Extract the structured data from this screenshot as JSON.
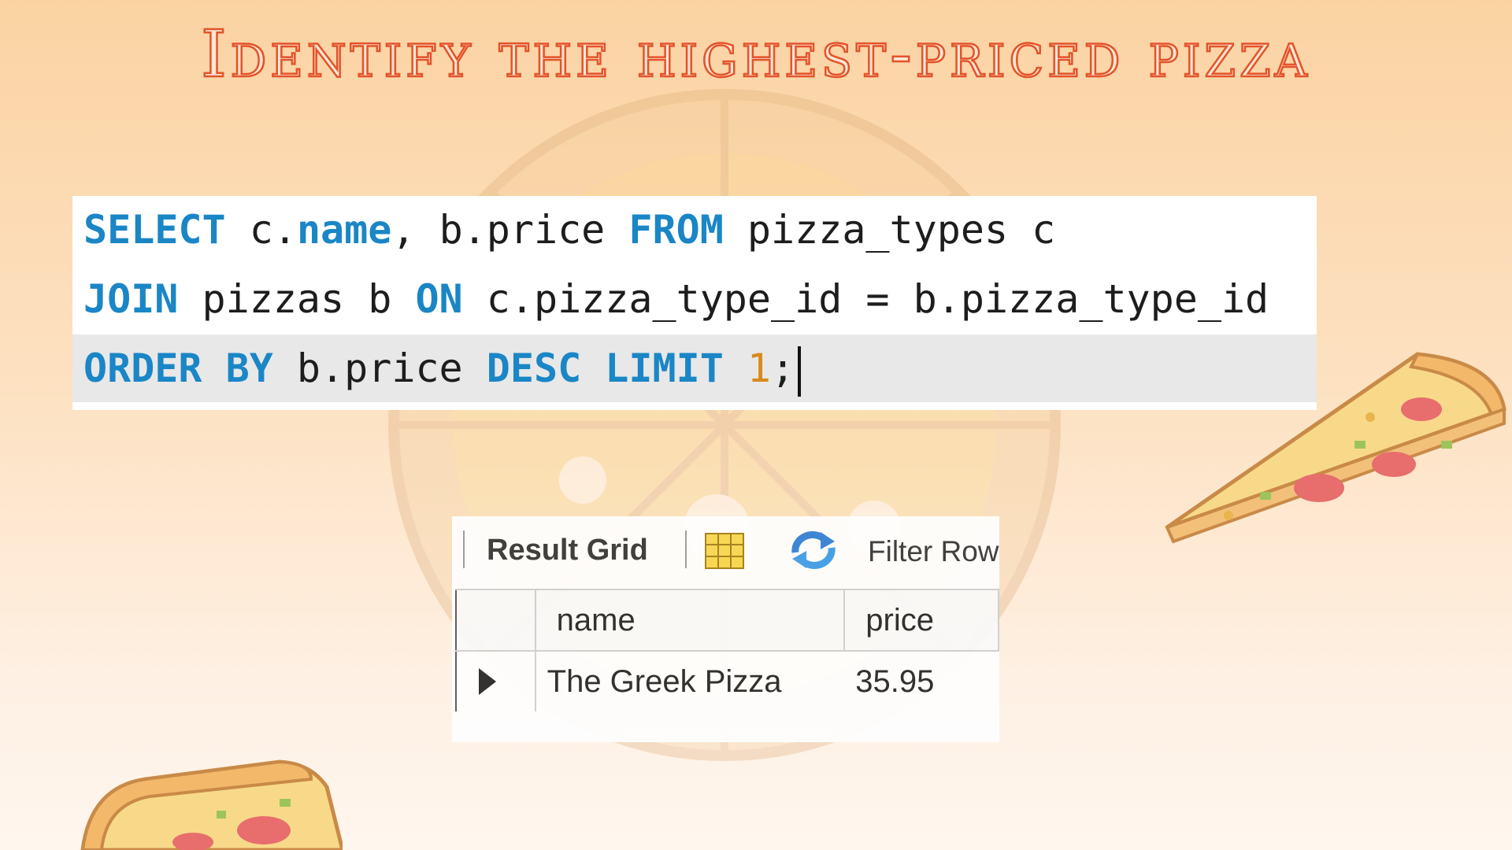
{
  "title": "Identify the highest-priced pizza",
  "query": {
    "line1": [
      "SELECT",
      " c.",
      "name",
      ", b.price ",
      "FROM",
      " pizza_types c"
    ],
    "line2": [
      "JOIN",
      " pizzas b ",
      "ON",
      " c.pizza_type_id = b.pizza_type_id"
    ],
    "line3": [
      "ORDER BY",
      " b.price ",
      "DESC LIMIT",
      " ",
      "1",
      ";"
    ]
  },
  "result_grid": {
    "tab_label": "Result Grid",
    "filter_label": "Filter Rows",
    "icons": [
      "grid-icon",
      "refresh-icon",
      "row-pointer-icon"
    ],
    "columns": [
      "name",
      "price"
    ],
    "rows": [
      {
        "name": "The Greek Pizza",
        "price": "35.95"
      }
    ]
  },
  "colors": {
    "title_outline": "#e4532a",
    "keyword": "#1a86c6",
    "number": "#d98a1d",
    "background_top": "#fbd3a3"
  }
}
